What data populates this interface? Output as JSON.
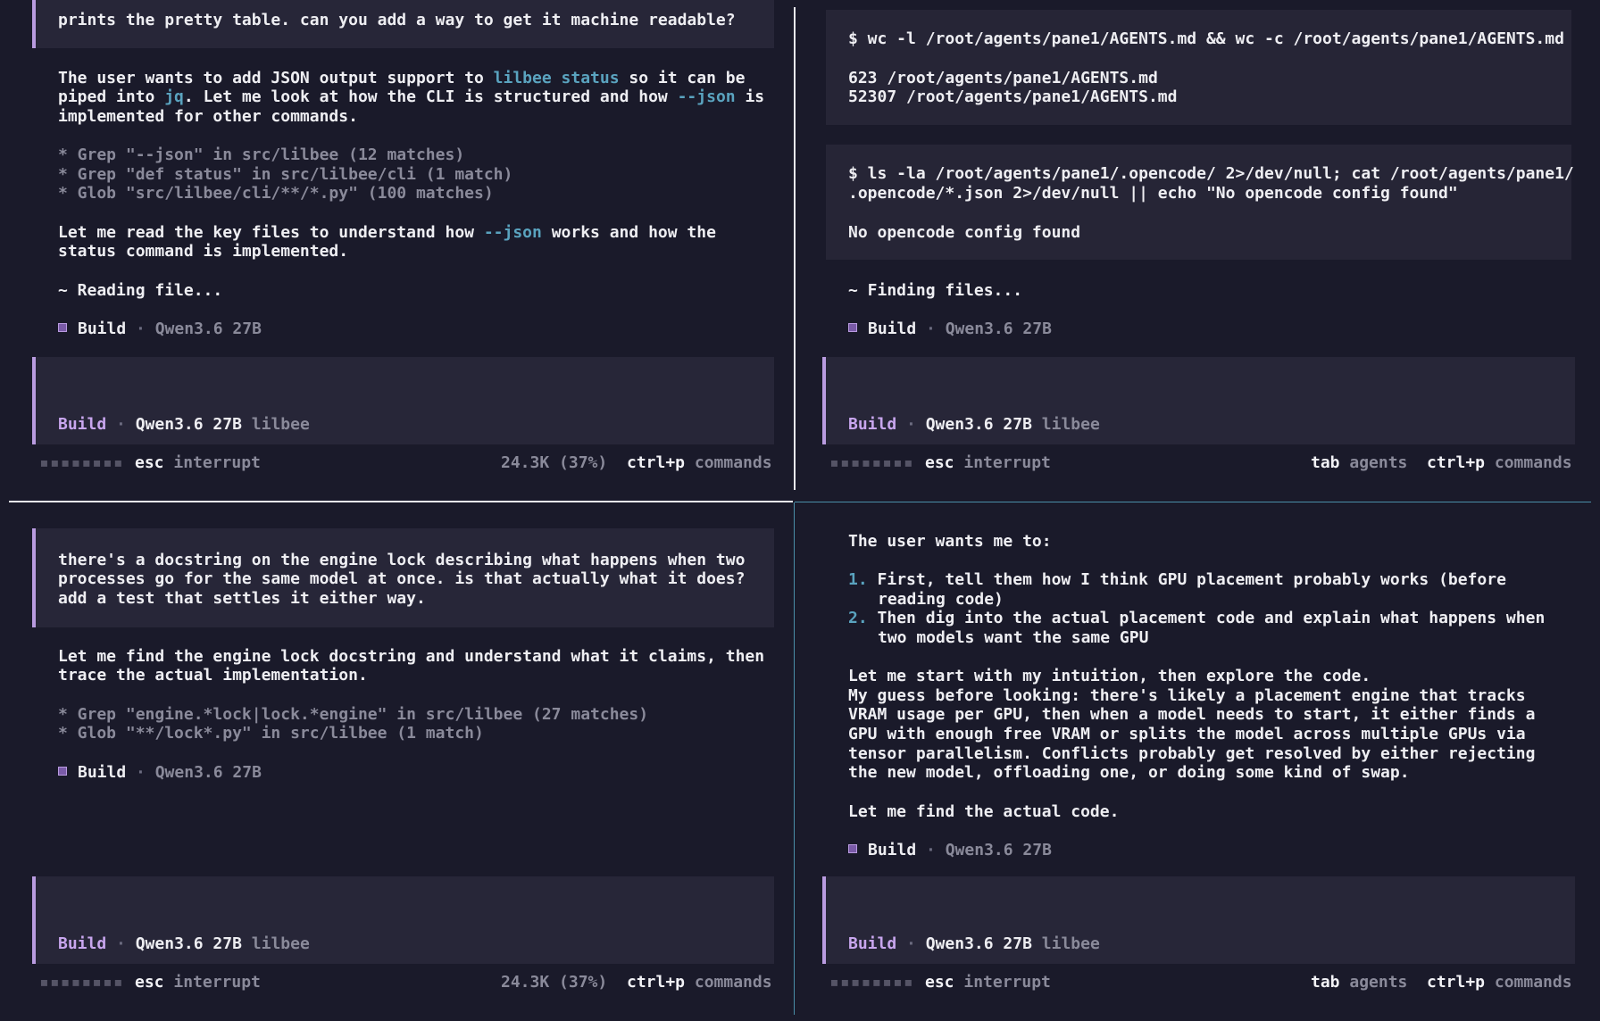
{
  "colors": {
    "accent": "#b99be0",
    "link": "#5aa3bf",
    "bg": "#1a1a2a",
    "panel": "#272638"
  },
  "tl": {
    "user_msg": "prints the pretty table. can you add a way to get it machine readable?",
    "p1_a": "The user wants to add JSON output support to ",
    "p1_hl1": "lilbee status",
    "p1_b": " so it can be",
    "p1_l2_a": "piped into ",
    "p1_hl2": "jq",
    "p1_l2_b": ". Let me look at how the CLI is structured and how ",
    "p1_hl3": "--json",
    "p1_l2_c": " is",
    "p1_l3": "implemented for other commands.",
    "tools": [
      "* Grep \"--json\" in src/lilbee (12 matches)",
      "* Grep \"def status\" in src/lilbee/cli (1 match)",
      "* Glob \"src/lilbee/cli/**/*.py\" (100 matches)"
    ],
    "p2_a": "Let me read the key files to understand how ",
    "p2_hl": "--json",
    "p2_b": " works and how the",
    "p2_l2": "status command is implemented.",
    "reading": "~ Reading file...",
    "status_agent": "Build",
    "status_model": "Qwen3.6 27B",
    "input_agent": "Build",
    "input_model": "Qwen3.6 27B",
    "input_project": "lilbee",
    "footer_key1": "esc",
    "footer_lbl1": "interrupt",
    "footer_tokens": "24.3K (37%)",
    "footer_key2": "ctrl+p",
    "footer_lbl2": "commands"
  },
  "tr": {
    "cmd1": "$ wc -l /root/agents/pane1/AGENTS.md && wc -c /root/agents/pane1/AGENTS.md",
    "out1": [
      "623 /root/agents/pane1/AGENTS.md",
      "52307 /root/agents/pane1/AGENTS.md"
    ],
    "cmd2": [
      "$ ls -la /root/agents/pane1/.opencode/ 2>/dev/null; cat /root/agents/pane1/",
      ".opencode/*.json 2>/dev/null || echo \"No opencode config found\""
    ],
    "out2": "No opencode config found",
    "finding": "~ Finding files...",
    "status_agent": "Build",
    "status_model": "Qwen3.6 27B",
    "input_agent": "Build",
    "input_model": "Qwen3.6 27B",
    "input_project": "lilbee",
    "footer_key1": "esc",
    "footer_lbl1": "interrupt",
    "footer_key_tab": "tab",
    "footer_lbl_tab": "agents",
    "footer_key2": "ctrl+p",
    "footer_lbl2": "commands"
  },
  "bl": {
    "user_msg": [
      "there's a docstring on the engine lock describing what happens when two",
      "processes go for the same model at once. is that actually what it does?",
      "add a test that settles it either way."
    ],
    "p1": [
      "Let me find the engine lock docstring and understand what it claims, then",
      "trace the actual implementation."
    ],
    "tools": [
      "* Grep \"engine.*lock|lock.*engine\" in src/lilbee (27 matches)",
      "* Glob \"**/lock*.py\" in src/lilbee (1 match)"
    ],
    "status_agent": "Build",
    "status_model": "Qwen3.6 27B",
    "input_agent": "Build",
    "input_model": "Qwen3.6 27B",
    "input_project": "lilbee",
    "footer_key1": "esc",
    "footer_lbl1": "interrupt",
    "footer_tokens": "24.3K (37%)",
    "footer_key2": "ctrl+p",
    "footer_lbl2": "commands"
  },
  "br": {
    "intro": "The user wants me to:",
    "list": [
      {
        "n": "1.",
        "l1": "First, tell them how I think GPU placement probably works (before",
        "l2": "reading code)"
      },
      {
        "n": "2.",
        "l1": "Then dig into the actual placement code and explain what happens when",
        "l2": "two models want the same GPU"
      }
    ],
    "para": [
      "Let me start with my intuition, then explore the code.",
      "My guess before looking: there's likely a placement engine that tracks",
      "VRAM usage per GPU, then when a model needs to start, it either finds a",
      "GPU with enough free VRAM or splits the model across multiple GPUs via",
      "tensor parallelism. Conflicts probably get resolved by either rejecting",
      "the new model, offloading one, or doing some kind of swap."
    ],
    "find": "Let me find the actual code.",
    "status_agent": "Build",
    "status_model": "Qwen3.6 27B",
    "input_agent": "Build",
    "input_model": "Qwen3.6 27B",
    "input_project": "lilbee",
    "footer_key1": "esc",
    "footer_lbl1": "interrupt",
    "footer_key_tab": "tab",
    "footer_lbl_tab": "agents",
    "footer_key2": "ctrl+p",
    "footer_lbl2": "commands"
  }
}
